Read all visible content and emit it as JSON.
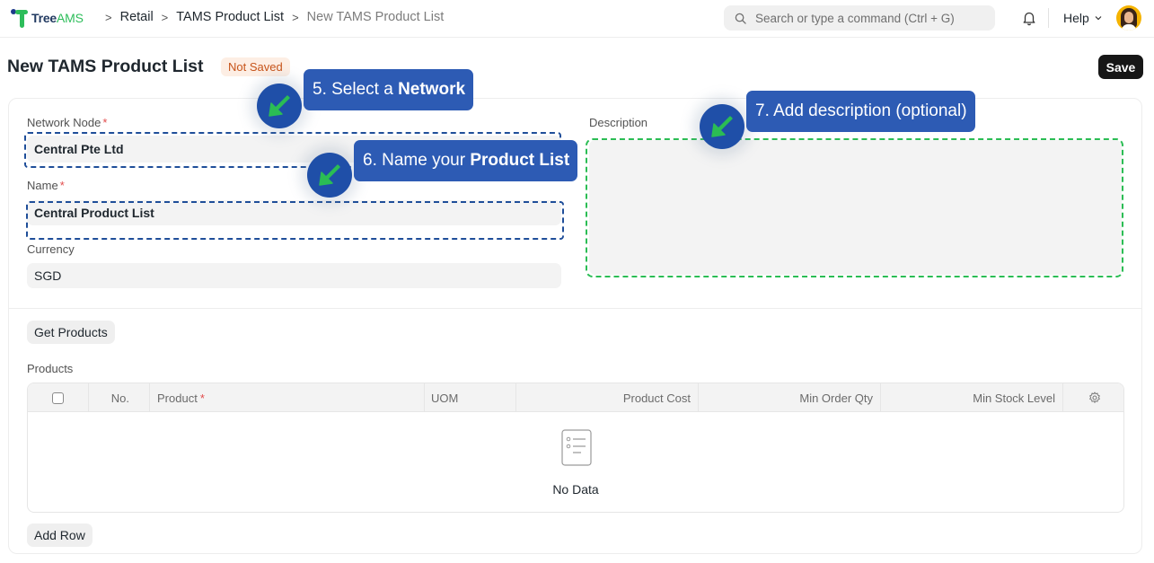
{
  "nav": {
    "logo_tree": "Tree",
    "logo_ams": "AMS",
    "breadcrumbs": [
      "Retail",
      "TAMS Product List",
      "New TAMS Product List"
    ],
    "search_placeholder": "Search or type a command (Ctrl + G)",
    "help_label": "Help"
  },
  "header": {
    "title": "New TAMS Product List",
    "status": "Not Saved",
    "save_label": "Save"
  },
  "form": {
    "network_node": {
      "label": "Network Node",
      "required_mark": "*",
      "value": "Central Pte Ltd"
    },
    "name": {
      "label": "Name",
      "required_mark": "*",
      "value": "Central Product List"
    },
    "currency": {
      "label": "Currency",
      "value": "SGD"
    },
    "description": {
      "label": "Description",
      "value": ""
    }
  },
  "products": {
    "get_products_label": "Get Products",
    "section_label": "Products",
    "columns": [
      "No.",
      "Product",
      "UOM",
      "Product Cost",
      "Min Order Qty",
      "Min Stock Level"
    ],
    "product_required_mark": "*",
    "empty_text": "No Data",
    "add_row_label": "Add Row"
  },
  "tutorial": {
    "step5": {
      "prefix": "5. Select a ",
      "bold": "Network"
    },
    "step6": {
      "prefix": "6. Name your ",
      "bold": "Product List"
    },
    "step7": {
      "text": "7. Add description (optional)"
    }
  },
  "colors": {
    "callout_bg": "#2d5bb4",
    "pointer_bg": "#1f4fa8",
    "arrow_green": "#2bbd54",
    "dash_blue": "#1f4e99",
    "status_badge_text": "#c7541a"
  }
}
